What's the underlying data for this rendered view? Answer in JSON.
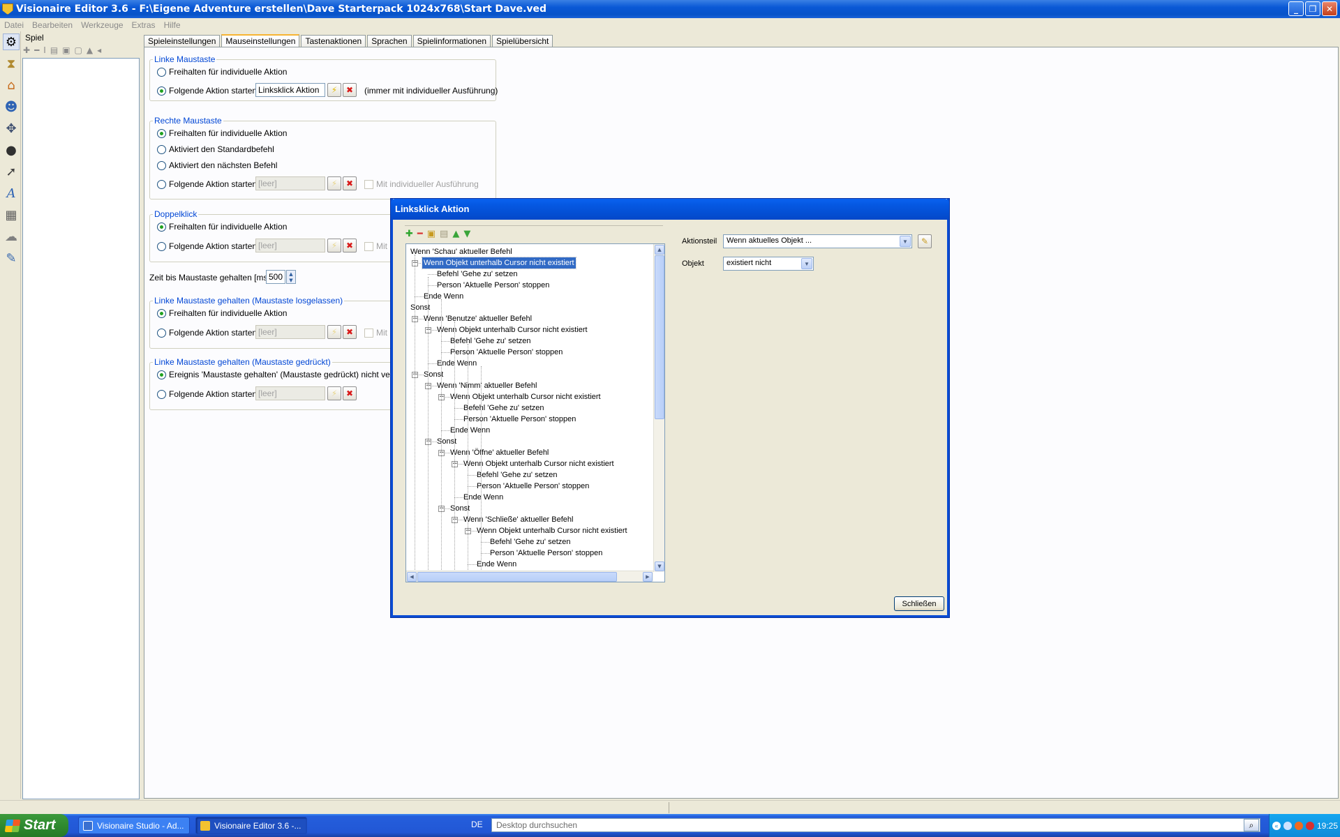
{
  "window": {
    "title": "Visionaire Editor 3.6 - F:\\Eigene Adventure erstellen\\Dave Starterpack 1024x768\\Start Dave.ved"
  },
  "menu": [
    "Datei",
    "Bearbeiten",
    "Werkzeuge",
    "Extras",
    "Hilfe"
  ],
  "game_panel": {
    "label": "Spiel"
  },
  "tabs": [
    "Spieleinstellungen",
    "Mauseinstellungen",
    "Tastenaktionen",
    "Sprachen",
    "Spielinformationen",
    "Spielübersicht"
  ],
  "active_tab": "Mauseinstellungen",
  "left_mouse": {
    "legend": "Linke Maustaste",
    "opt_free": "Freihalten für individuelle Aktion",
    "opt_action": "Folgende Aktion starten",
    "action_value": "Linksklick Aktion",
    "note": "(immer mit individueller Ausführung)"
  },
  "right_mouse": {
    "legend": "Rechte Maustaste",
    "opt_free": "Freihalten für individuelle Aktion",
    "opt_default": "Aktiviert den Standardbefehl",
    "opt_next": "Aktiviert den nächsten Befehl",
    "opt_action": "Folgende Aktion starten",
    "action_value": "[leer]",
    "individual_check": "Mit individueller Ausführung"
  },
  "double_click": {
    "legend": "Doppelklick",
    "opt_free": "Freihalten für individuelle Aktion",
    "opt_action": "Folgende Aktion starten",
    "action_value": "[leer]",
    "individual_check": "Mit i"
  },
  "hold_time": {
    "label": "Zeit bis Maustaste gehalten [ms]",
    "value": "500"
  },
  "hold_released": {
    "legend": "Linke Maustaste gehalten (Maustaste losgelassen)",
    "opt_free": "Freihalten für individuelle Aktion",
    "opt_action": "Folgende Aktion starten",
    "action_value": "[leer]",
    "individual_check": "Mit i"
  },
  "hold_pressed": {
    "legend": "Linke Maustaste gehalten (Maustaste gedrückt)",
    "opt_event": "Ereignis 'Maustaste gehalten' (Maustaste gedrückt) nicht verwende",
    "opt_action": "Folgende Aktion starten",
    "action_value": "[leer]"
  },
  "dialog": {
    "title": "Linksklick Aktion",
    "tree": [
      {
        "text": "Wenn 'Schau' aktueller Befehl",
        "level": 0,
        "toggle": false
      },
      {
        "text": "Wenn Objekt unterhalb Cursor nicht existiert",
        "level": 1,
        "toggle": true,
        "selected": true
      },
      {
        "text": "Befehl 'Gehe zu' setzen",
        "level": 2,
        "toggle": false
      },
      {
        "text": "Person 'Aktuelle Person' stoppen",
        "level": 2,
        "toggle": false
      },
      {
        "text": "Ende Wenn",
        "level": 1,
        "toggle": false
      },
      {
        "text": "Sonst",
        "level": 0,
        "toggle": false
      },
      {
        "text": "Wenn 'Benutze' aktueller Befehl",
        "level": 1,
        "toggle": true
      },
      {
        "text": "Wenn Objekt unterhalb Cursor nicht existiert",
        "level": 2,
        "toggle": true
      },
      {
        "text": "Befehl 'Gehe zu' setzen",
        "level": 3,
        "toggle": false
      },
      {
        "text": "Person 'Aktuelle Person' stoppen",
        "level": 3,
        "toggle": false
      },
      {
        "text": "Ende Wenn",
        "level": 2,
        "toggle": false
      },
      {
        "text": "Sonst",
        "level": 1,
        "toggle": true
      },
      {
        "text": "Wenn 'Nimm' aktueller Befehl",
        "level": 2,
        "toggle": true
      },
      {
        "text": "Wenn Objekt unterhalb Cursor nicht existiert",
        "level": 3,
        "toggle": true
      },
      {
        "text": "Befehl 'Gehe zu' setzen",
        "level": 4,
        "toggle": false
      },
      {
        "text": "Person 'Aktuelle Person' stoppen",
        "level": 4,
        "toggle": false
      },
      {
        "text": "Ende Wenn",
        "level": 3,
        "toggle": false
      },
      {
        "text": "Sonst",
        "level": 2,
        "toggle": true
      },
      {
        "text": "Wenn 'Öffne' aktueller Befehl",
        "level": 3,
        "toggle": true
      },
      {
        "text": "Wenn Objekt unterhalb Cursor nicht existiert",
        "level": 4,
        "toggle": true
      },
      {
        "text": "Befehl 'Gehe zu' setzen",
        "level": 5,
        "toggle": false
      },
      {
        "text": "Person 'Aktuelle Person' stoppen",
        "level": 5,
        "toggle": false
      },
      {
        "text": "Ende Wenn",
        "level": 4,
        "toggle": false
      },
      {
        "text": "Sonst",
        "level": 3,
        "toggle": true
      },
      {
        "text": "Wenn 'Schließe' aktueller Befehl",
        "level": 4,
        "toggle": true
      },
      {
        "text": "Wenn Objekt unterhalb Cursor nicht existiert",
        "level": 5,
        "toggle": true
      },
      {
        "text": "Befehl 'Gehe zu' setzen",
        "level": 6,
        "toggle": false
      },
      {
        "text": "Person 'Aktuelle Person' stoppen",
        "level": 6,
        "toggle": false
      },
      {
        "text": "Ende Wenn",
        "level": 5,
        "toggle": false
      }
    ],
    "aktionsteil_label": "Aktionsteil",
    "aktionsteil_value": "Wenn aktuelles Objekt ...",
    "objekt_label": "Objekt",
    "objekt_value": "existiert nicht",
    "close_label": "Schließen"
  },
  "taskbar": {
    "start": "Start",
    "items": [
      "Visionaire Studio - Ad...",
      "Visionaire Editor 3.6 -..."
    ],
    "lang": "DE",
    "search_placeholder": "Desktop durchsuchen",
    "clock": "19:25"
  },
  "colors": {
    "accent": "#0a58d6",
    "legend_blue": "#0046d5",
    "selection": "#316ac5"
  }
}
